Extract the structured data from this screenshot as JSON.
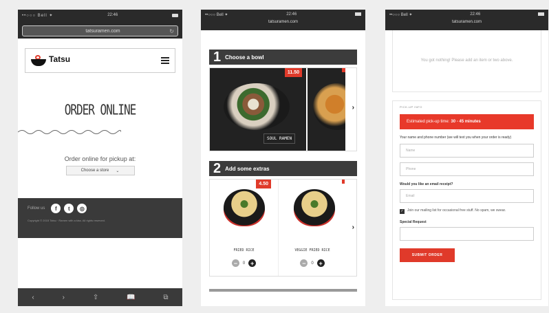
{
  "screen1": {
    "url": "tatsuramen.com",
    "logo_name": "Tatsu",
    "page_title": "ORDER ONLINE",
    "pickup_label": "Order online for pickup at:",
    "store_select": "Choose a store",
    "follow_label": "Follow us",
    "social": [
      "f",
      "t",
      "◎"
    ],
    "copyright": "Copyright © 2015 Tatsu · Ramen with a kiss. All rights reserved.",
    "browser_bar": [
      "‹",
      "›",
      "⇧",
      "📖",
      "⧉"
    ]
  },
  "screen2": {
    "url": "tatsuramen.com",
    "step1": {
      "num": "1",
      "title": "Choose a bowl"
    },
    "bowl": {
      "price": "11.50",
      "name": "SOUL RAMEN"
    },
    "step2": {
      "num": "2",
      "title": "Add some extras"
    },
    "extras": [
      {
        "price": "4.50",
        "name": "FRIED RICE",
        "qty": "0"
      },
      {
        "name": "VEGGIE FRIED RICE",
        "qty": "0"
      }
    ],
    "chevron": "›"
  },
  "screen3": {
    "url": "tatsuramen.com",
    "empty_text": "You got nothing! Please add an item or two above.",
    "section_label": "PICK-UP INFO",
    "estimate_prefix": "Estimated pick-up time:",
    "estimate_value": "30 - 45 minutes",
    "help_text": "Your name and phone number (we will text you when your order is ready)",
    "name_placeholder": "Name",
    "phone_placeholder": "Phone",
    "email_question": "Would you like an email receipt?",
    "email_placeholder": "Email",
    "mailing_text": "Join our mailing list for occasional free stuff. No spam, we swear.",
    "special_label": "Special Request",
    "submit_label": "SUBMIT ORDER"
  },
  "status": {
    "carrier": "••○○○ Bell ✦",
    "time": "22:46"
  },
  "colors": {
    "accent": "#e03a2a",
    "dark": "#3c3c3c"
  }
}
